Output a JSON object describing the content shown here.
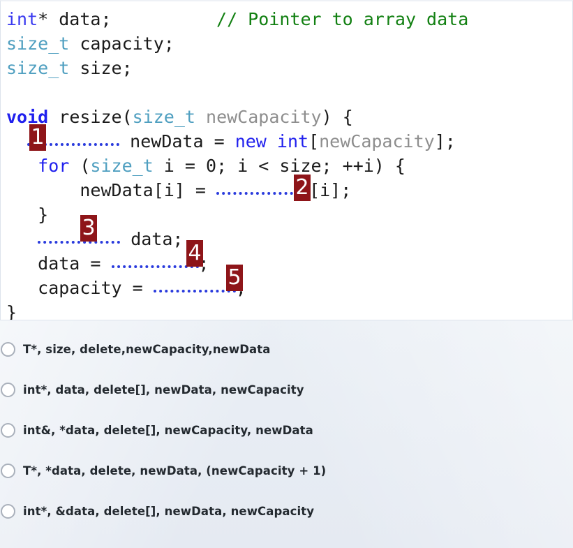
{
  "code_panel": {
    "language": "cpp",
    "lines": [
      {
        "id": "line-1",
        "segments": [
          {
            "cls": "t-int",
            "text": "int"
          },
          {
            "cls": "t-plain",
            "text": "* data;          "
          },
          {
            "cls": "t-comment",
            "text": "// Pointer to array data"
          }
        ]
      },
      {
        "id": "line-2",
        "segments": [
          {
            "cls": "t-type",
            "text": "size_t"
          },
          {
            "cls": "t-plain",
            "text": " capacity;"
          }
        ]
      },
      {
        "id": "line-3",
        "segments": [
          {
            "cls": "t-type",
            "text": "size_t"
          },
          {
            "cls": "t-plain",
            "text": " size;"
          }
        ]
      },
      {
        "id": "line-4",
        "segments": []
      },
      {
        "id": "line-5",
        "segments": [
          {
            "cls": "t-kw",
            "text": "void"
          },
          {
            "cls": "t-plain",
            "text": " resize("
          },
          {
            "cls": "t-type",
            "text": "size_t"
          },
          {
            "cls": "t-plain",
            "text": " "
          },
          {
            "cls": "t-param",
            "text": "newCapacity"
          },
          {
            "cls": "t-plain",
            "text": ") {"
          }
        ]
      },
      {
        "id": "line-6",
        "segments": [
          {
            "cls": "t-plain",
            "text": "  "
          },
          {
            "blank": "b1"
          },
          {
            "cls": "t-plain",
            "text": " newData = "
          },
          {
            "cls": "t-kw2",
            "text": "new int"
          },
          {
            "cls": "t-plain",
            "text": "["
          },
          {
            "cls": "t-param",
            "text": "newCapacity"
          },
          {
            "cls": "t-plain",
            "text": "];"
          }
        ]
      },
      {
        "id": "line-7",
        "segments": [
          {
            "cls": "t-plain",
            "text": "   "
          },
          {
            "cls": "t-kw2",
            "text": "for"
          },
          {
            "cls": "t-plain",
            "text": " ("
          },
          {
            "cls": "t-type",
            "text": "size_t"
          },
          {
            "cls": "t-plain",
            "text": " i = 0; i < size; ++i) {"
          }
        ]
      },
      {
        "id": "line-8",
        "segments": [
          {
            "cls": "t-plain",
            "text": "       newData[i] = "
          },
          {
            "blank": "b2"
          },
          {
            "cls": "t-plain",
            "text": " [i];"
          }
        ]
      },
      {
        "id": "line-9",
        "segments": [
          {
            "cls": "t-plain",
            "text": "   }"
          }
        ]
      },
      {
        "id": "line-10",
        "segments": [
          {
            "cls": "t-plain",
            "text": "   "
          },
          {
            "blank": "b3"
          },
          {
            "cls": "t-plain",
            "text": " data;"
          }
        ]
      },
      {
        "id": "line-11",
        "segments": [
          {
            "cls": "t-plain",
            "text": "   data = "
          },
          {
            "blank": "b4"
          },
          {
            "cls": "t-plain",
            "text": ";"
          }
        ]
      },
      {
        "id": "line-12",
        "segments": [
          {
            "cls": "t-plain",
            "text": "   capacity = "
          },
          {
            "blank": "b5"
          },
          {
            "cls": "t-plain",
            "text": ";"
          }
        ]
      },
      {
        "id": "line-13",
        "segments": [
          {
            "cls": "t-plain",
            "text": "}"
          }
        ]
      }
    ],
    "badges": [
      {
        "id": "badge1",
        "label": "1"
      },
      {
        "id": "badge2",
        "label": "2"
      },
      {
        "id": "badge3",
        "label": "3"
      },
      {
        "id": "badge4",
        "label": "4"
      },
      {
        "id": "badge5",
        "label": "5"
      }
    ],
    "colors": {
      "background": "#ffffff",
      "border": "#dde3ec",
      "comment": "#128012",
      "type": "#4f9fc0",
      "keyword": "#2020ee",
      "parameter": "#8e8e8e",
      "plain": "#1b1b1b",
      "blank_dots": "#2a3bdd",
      "badge_background": "#8e1519",
      "badge_text": "#ffffff"
    }
  },
  "answers": {
    "selected": null,
    "background": "#e7ecf3",
    "options": [
      {
        "id": "option-a",
        "label": "T*, size, delete,newCapacity,newData",
        "checked": false
      },
      {
        "id": "option-b",
        "label": "int*, data, delete[], newData, newCapacity",
        "checked": false
      },
      {
        "id": "option-c",
        "label": "int&, *data, delete[], newCapacity, newData",
        "checked": false
      },
      {
        "id": "option-d",
        "label": "T*, *data, delete, newData, (newCapacity + 1)",
        "checked": false
      },
      {
        "id": "option-e",
        "label": "int*, &data, delete[], newData, newCapacity",
        "checked": false
      }
    ]
  }
}
